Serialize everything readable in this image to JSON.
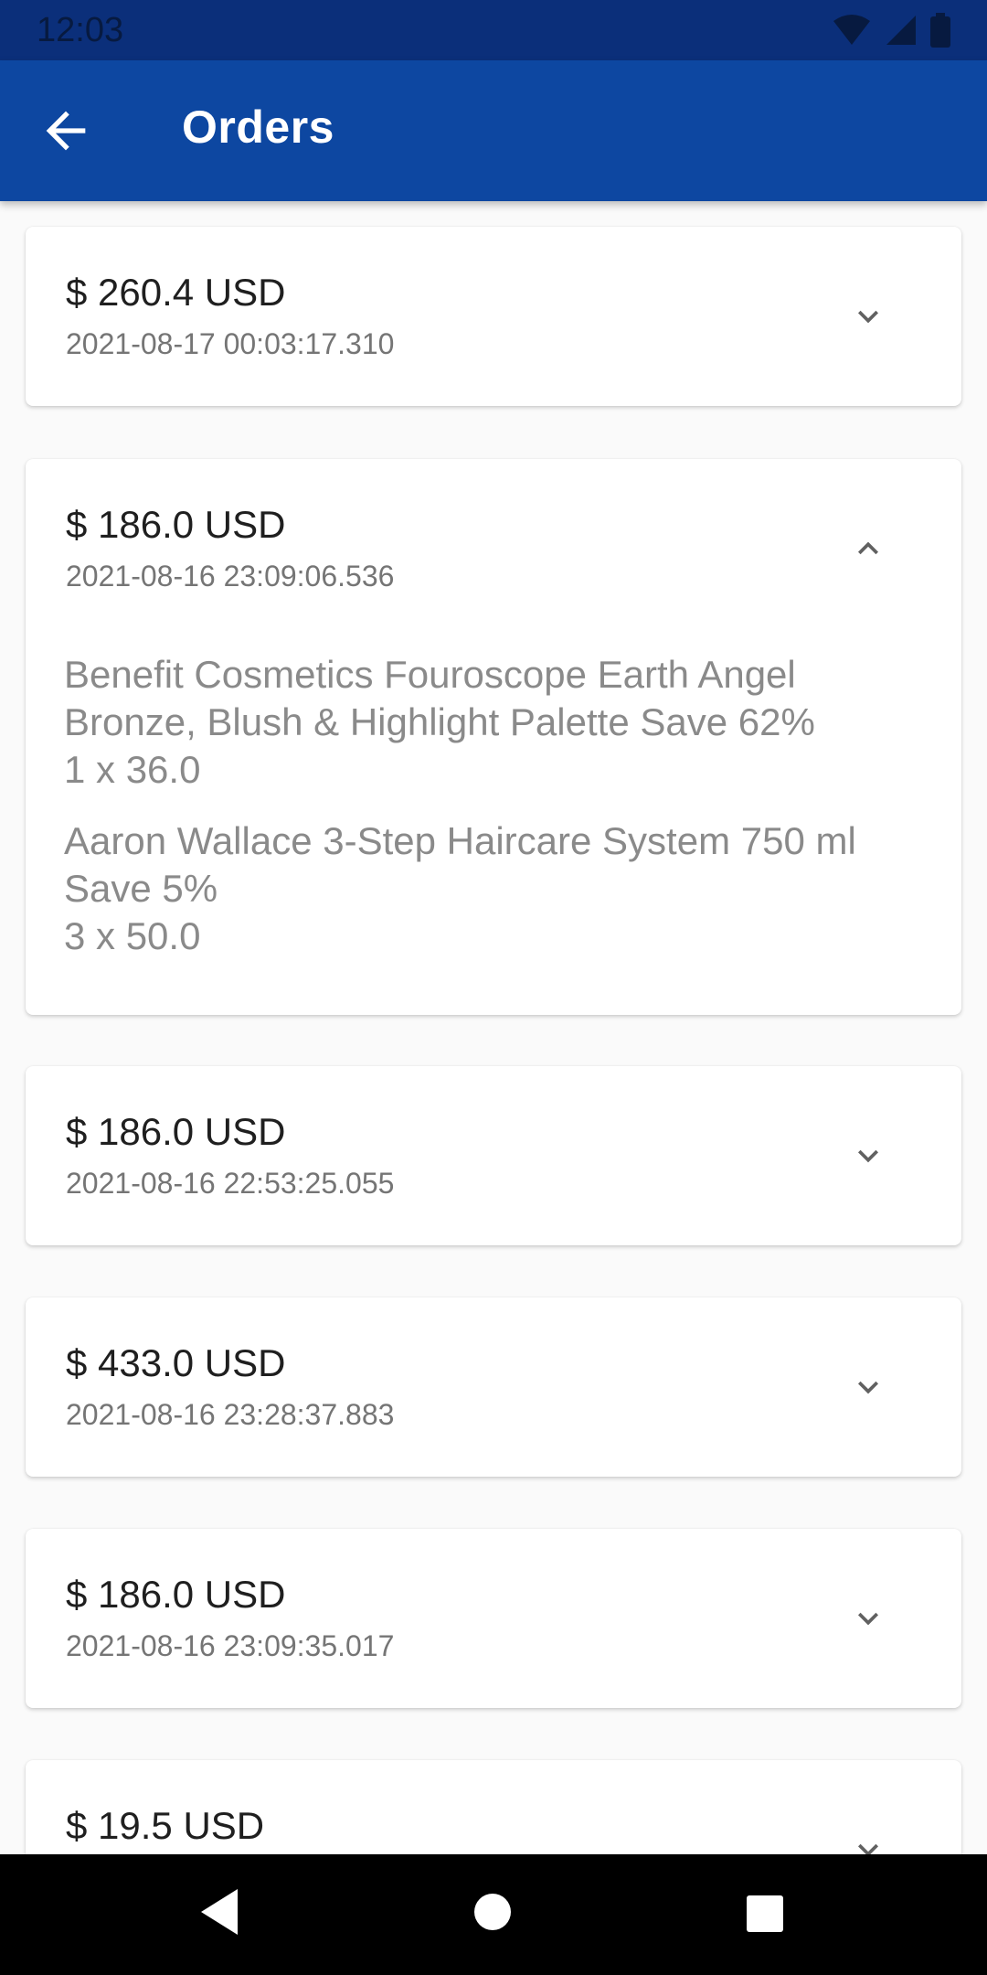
{
  "status_bar": {
    "time": "12:03"
  },
  "app_bar": {
    "title": "Orders"
  },
  "orders": [
    {
      "amount": "$ 260.4 USD",
      "date": "2021-08-17 00:03:17.310",
      "expanded": false
    },
    {
      "amount": "$ 186.0 USD",
      "date": "2021-08-16 23:09:06.536",
      "expanded": true,
      "items": [
        {
          "name": "Benefit Cosmetics Fouroscope Earth Angel Bronze, Blush & Highlight Palette Save 62%",
          "qty": "1 x 36.0"
        },
        {
          "name": "Aaron Wallace 3-Step Haircare System 750 ml Save 5%",
          "qty": "3 x 50.0"
        }
      ]
    },
    {
      "amount": "$ 186.0 USD",
      "date": "2021-08-16 22:53:25.055",
      "expanded": false
    },
    {
      "amount": "$ 433.0 USD",
      "date": "2021-08-16 23:28:37.883",
      "expanded": false
    },
    {
      "amount": "$ 186.0 USD",
      "date": "2021-08-16 23:09:35.017",
      "expanded": false
    },
    {
      "amount": "$ 19.5 USD",
      "date": "",
      "expanded": false
    }
  ],
  "icons": {
    "back": "arrow-back-icon",
    "expand": "chevron-down-icon",
    "collapse": "chevron-up-icon"
  },
  "colors": {
    "status_bar": "#0b2f7a",
    "app_bar": "#0d47a1",
    "background": "#fafafa"
  }
}
